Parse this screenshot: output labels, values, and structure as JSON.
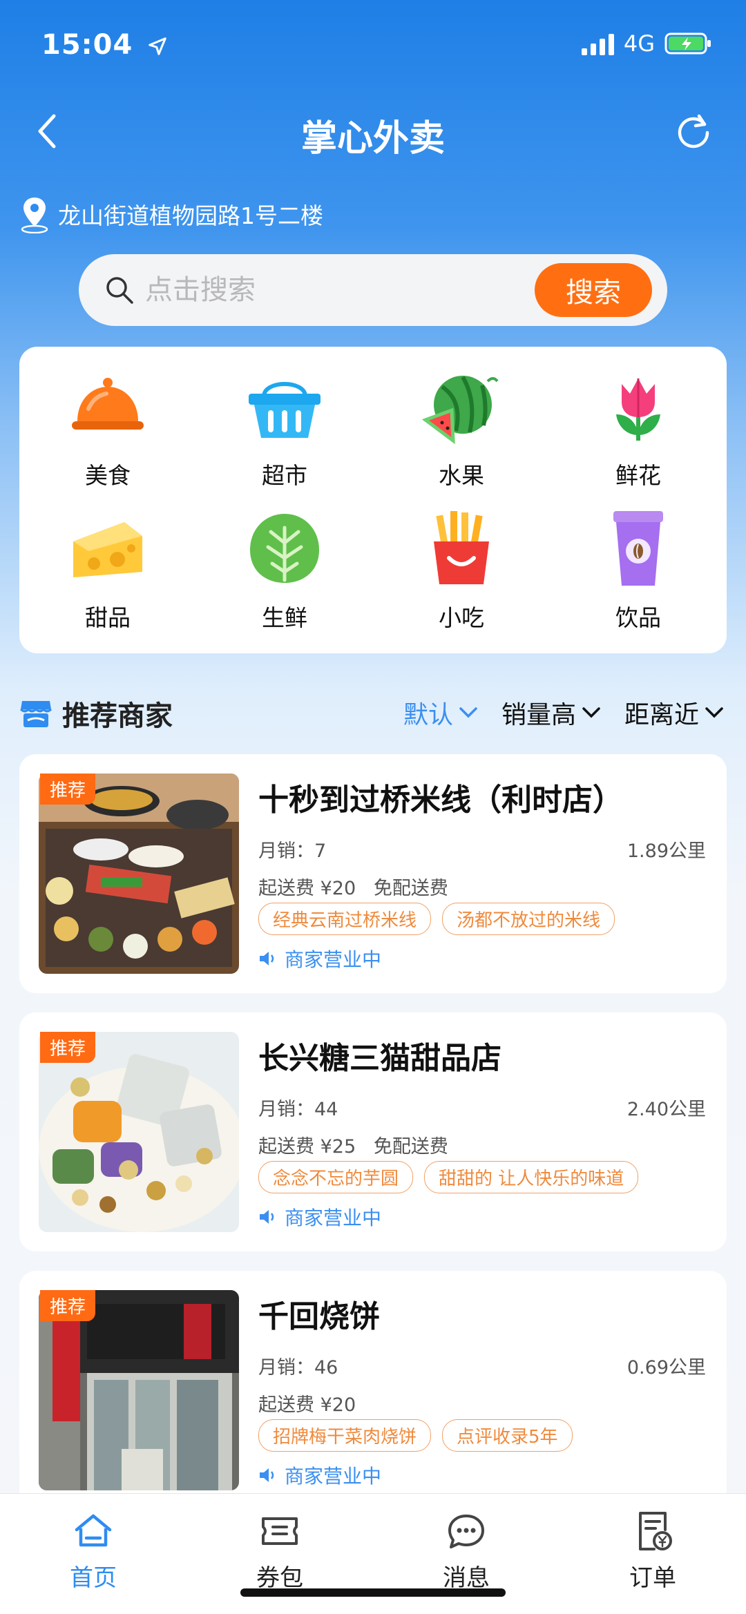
{
  "status_bar": {
    "time": "15:04",
    "network": "4G"
  },
  "header": {
    "title": "掌心外卖"
  },
  "location": {
    "address": "龙山街道植物园路1号二楼"
  },
  "search": {
    "placeholder": "点击搜索",
    "button_label": "搜索"
  },
  "categories": [
    {
      "label": "美食",
      "icon": "cloche-icon"
    },
    {
      "label": "超市",
      "icon": "basket-icon"
    },
    {
      "label": "水果",
      "icon": "watermelon-icon"
    },
    {
      "label": "鲜花",
      "icon": "tulip-icon"
    },
    {
      "label": "甜品",
      "icon": "cheese-icon"
    },
    {
      "label": "生鲜",
      "icon": "lettuce-icon"
    },
    {
      "label": "小吃",
      "icon": "fries-icon"
    },
    {
      "label": "饮品",
      "icon": "coffee-cup-icon"
    }
  ],
  "section": {
    "title": "推荐商家",
    "sort_tabs": [
      {
        "label": "默认",
        "active": true
      },
      {
        "label": "销量高",
        "active": false
      },
      {
        "label": "距离近",
        "active": false
      }
    ]
  },
  "shops": [
    {
      "badge": "推荐",
      "name": "十秒到过桥米线（利时店）",
      "monthly_sales": "月销：7",
      "distance": "1.89公里",
      "delivery": "起送费 ¥20   免配送费",
      "tags": [
        "经典云南过桥米线",
        "汤都不放过的米线"
      ],
      "status": "商家营业中"
    },
    {
      "badge": "推荐",
      "name": "长兴糖三猫甜品店",
      "monthly_sales": "月销：44",
      "distance": "2.40公里",
      "delivery": "起送费 ¥25   免配送费",
      "tags": [
        "念念不忘的芋圆",
        "甜甜的 让人快乐的味道"
      ],
      "status": "商家营业中"
    },
    {
      "badge": "推荐",
      "name": "千回烧饼",
      "monthly_sales": "月销：46",
      "distance": "0.69公里",
      "delivery": "起送费 ¥20",
      "tags": [
        "招牌梅干菜肉烧饼",
        "点评收录5年"
      ],
      "status": "商家营业中"
    }
  ],
  "bottom_nav": [
    {
      "label": "首页",
      "icon": "home-icon",
      "active": true
    },
    {
      "label": "券包",
      "icon": "ticket-icon",
      "active": false
    },
    {
      "label": "消息",
      "icon": "chat-icon",
      "active": false
    },
    {
      "label": "订单",
      "icon": "order-icon",
      "active": false
    }
  ],
  "colors": {
    "primary_blue": "#2f8cf0",
    "accent_orange": "#ff6f12"
  }
}
